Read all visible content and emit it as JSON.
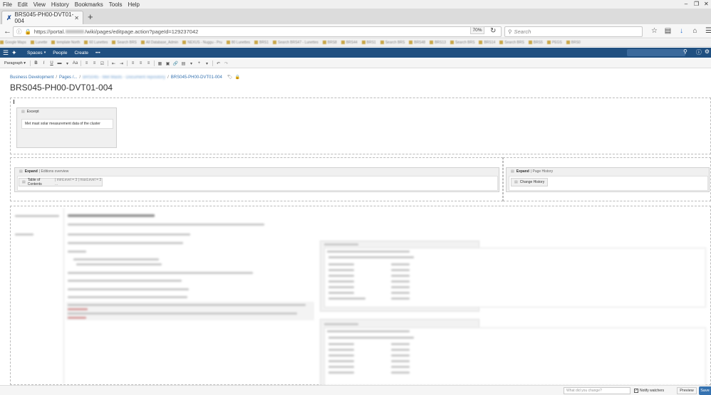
{
  "browser": {
    "menu": [
      "File",
      "Edit",
      "View",
      "History",
      "Bookmarks",
      "Tools",
      "Help"
    ],
    "tab_title": "BRS045-PH00-DVT01-004",
    "url": "https://portal.",
    "url_rest": "/wiki/pages/editpage.action?pageId=129237042",
    "zoom": "70%",
    "search_placeholder": "Search"
  },
  "bookmarks": [
    "Google Maps",
    "Lunette",
    "template North",
    "60 Lunettes",
    "Search BRS",
    "All Database_Admin",
    "NEXUS - Nuggu - Pru",
    "80 Lunettes",
    "BRS1",
    "Search BRS47 - Lunettes",
    "BRS8",
    "BRS44",
    "BRS1",
    "Search BRS",
    "BRS48",
    "BRS13",
    "Search BRS",
    "BRS14",
    "Search BRS",
    "BRS5",
    "PEGS",
    "BRS0"
  ],
  "confluence": {
    "spaces": "Spaces",
    "people": "People",
    "create": "Create",
    "more": "•••"
  },
  "toolbar": {
    "paragraph": "Paragraph"
  },
  "page": {
    "breadcrumb": {
      "root": "Business Development",
      "pages": "Pages /...",
      "sep": "/",
      "hidden_parent": "BRS045 - Met Masts - Document repository",
      "current": "BRS045-PH00-DVT01-004"
    },
    "title": "BRS045-PH00-DVT01-004",
    "excerpt": {
      "label": "Excerpt",
      "text": "Met mast solar measurement data of the cluster"
    },
    "expand_editions": {
      "label": "Expand",
      "title": "| Editions overview",
      "body": "Table of Contents",
      "params": "| minLevel = 3 | maxLevel = 3 ..."
    },
    "expand_history": {
      "label": "Expand",
      "title": "| Page History",
      "body": "Change History"
    }
  },
  "footer": {
    "comment_placeholder": "What did you change?",
    "notify": "Notify watchers",
    "preview": "Preview",
    "save": "Save"
  }
}
